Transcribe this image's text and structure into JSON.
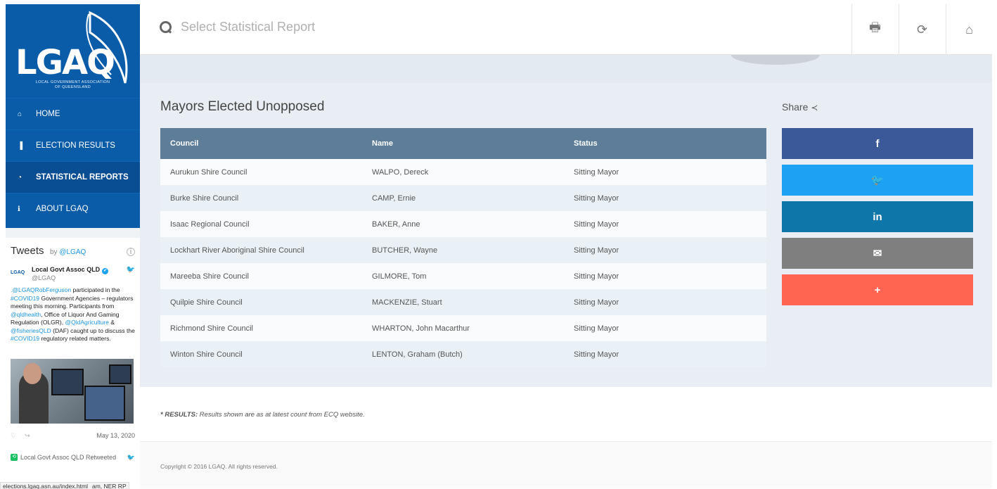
{
  "brand": {
    "logo_text": "LGAQ",
    "logo_subtitle_line1": "LOCAL GOVERNMENT ASSOCIATION",
    "logo_subtitle_line2": "OF QUEENSLAND",
    "primary_color": "#0a5ca8"
  },
  "nav": {
    "items": [
      {
        "label": "HOME",
        "icon": "home-icon",
        "glyph": "⌂"
      },
      {
        "label": "ELECTION RESULTS",
        "icon": "bar-chart-icon",
        "glyph": "▐"
      },
      {
        "label": "STATISTICAL REPORTS",
        "icon": "pie-chart-icon",
        "glyph": "◔",
        "active": true
      },
      {
        "label": "ABOUT LGAQ",
        "icon": "info-icon",
        "glyph": "ℹ"
      }
    ]
  },
  "tweets": {
    "title": "Tweets",
    "by": "by",
    "by_handle": "@LGAQ",
    "author_name": "Local Govt Assoc QLD",
    "author_handle": "@LGAQ",
    "avatar_text": "LGAQ",
    "body_parts": [
      {
        "t": ".@LGAQRobFerguson",
        "link": true
      },
      {
        "t": " participated in the ",
        "link": false
      },
      {
        "t": "#COVID19",
        "link": true
      },
      {
        "t": " Government Agencies – regulators meeting this morning. Participants from ",
        "link": false
      },
      {
        "t": "@qldhealth",
        "link": true
      },
      {
        "t": ", Office of Liquor And Gaming Regulation (OLGR), ",
        "link": false
      },
      {
        "t": "@QldAgriculture",
        "link": true
      },
      {
        "t": " & ",
        "link": false
      },
      {
        "t": "@fisheriesQLD",
        "link": true
      },
      {
        "t": " (DAF) caught up to discuss the ",
        "link": false
      },
      {
        "t": "#COVID19",
        "link": true
      },
      {
        "t": " regulatory related matters.",
        "link": false
      }
    ],
    "date": "May 13, 2020",
    "retweet_label": "Local Govt Assoc QLD Retweeted"
  },
  "status_bar": {
    "url": "elections.lgaq.asn.au/index.html",
    "trailing": "am, NER RP"
  },
  "search": {
    "placeholder": "Select Statistical Report"
  },
  "toolbar": {
    "print_icon": "print-icon",
    "refresh_icon": "refresh-icon",
    "home_icon": "home-icon"
  },
  "page": {
    "title": "Mayors Elected Unopposed",
    "share_label": "Share"
  },
  "table": {
    "columns": [
      "Council",
      "Name",
      "Status"
    ],
    "rows": [
      [
        "Aurukun Shire Council",
        "WALPO, Dereck",
        "Sitting Mayor"
      ],
      [
        "Burke Shire Council",
        "CAMP, Ernie",
        "Sitting Mayor"
      ],
      [
        "Isaac Regional Council",
        "BAKER, Anne",
        "Sitting Mayor"
      ],
      [
        "Lockhart River Aboriginal Shire Council",
        "BUTCHER, Wayne",
        "Sitting Mayor"
      ],
      [
        "Mareeba Shire Council",
        "GILMORE, Tom",
        "Sitting Mayor"
      ],
      [
        "Quilpie Shire Council",
        "MACKENZIE, Stuart",
        "Sitting Mayor"
      ],
      [
        "Richmond Shire Council",
        "WHARTON, John Macarthur",
        "Sitting Mayor"
      ],
      [
        "Winton Shire Council",
        "LENTON, Graham (Butch)",
        "Sitting Mayor"
      ]
    ]
  },
  "share_buttons": [
    {
      "name": "share-facebook-button",
      "label": "f",
      "color": "#3b5998",
      "icon": "facebook-icon"
    },
    {
      "name": "share-twitter-button",
      "label": "🐦",
      "color": "#1da1f2",
      "icon": "twitter-icon"
    },
    {
      "name": "share-linkedin-button",
      "label": "in",
      "color": "#0e76a8",
      "icon": "linkedin-icon"
    },
    {
      "name": "share-email-button",
      "label": "✉",
      "color": "#7f7f7f",
      "icon": "email-icon"
    },
    {
      "name": "share-more-button",
      "label": "+",
      "color": "#ff6550",
      "icon": "plus-icon"
    }
  ],
  "footer": {
    "note_label": "* RESULTS:",
    "note_text": " Results shown are as at latest count from ECQ website.",
    "copyright": "Copyright © 2016 LGAQ. All rights reserved."
  }
}
